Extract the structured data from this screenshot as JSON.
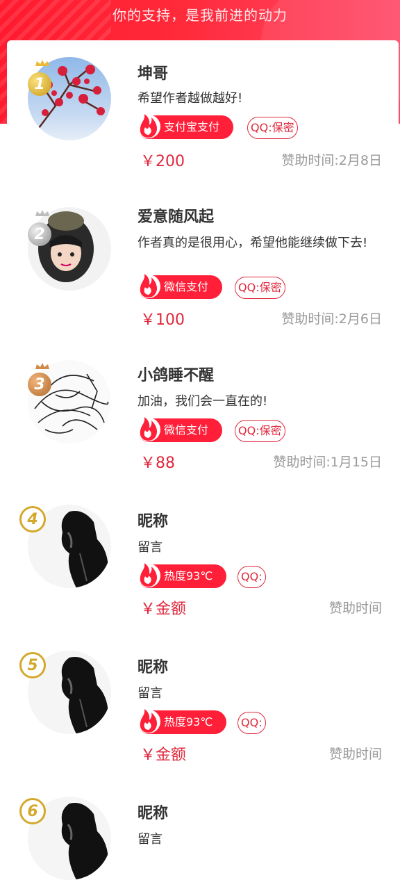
{
  "header": {
    "title": "你的支持，是我前进的动力"
  },
  "colors": {
    "accent": "#ff1f38",
    "gold": "#d4a82a",
    "muted": "#999999"
  },
  "entries": [
    {
      "rank": "1",
      "name": "坤哥",
      "message": "希望作者越做越好!",
      "pay": "支付宝支付",
      "qq": "QQ:保密",
      "amount": "￥200",
      "time": "赞助时间:2月8日"
    },
    {
      "rank": "2",
      "name": "爱意随风起",
      "message": "作者真的是很用心，希望他能继续做下去!",
      "pay": "微信支付",
      "qq": "QQ:保密",
      "amount": "￥100",
      "time": "赞助时间:2月6日"
    },
    {
      "rank": "3",
      "name": "小鸽睡不醒",
      "message": "加油，我们会一直在的!",
      "pay": "微信支付",
      "qq": "QQ:保密",
      "amount": "￥88",
      "time": "赞助时间:1月15日"
    },
    {
      "rank": "4",
      "name": "昵称",
      "message": "留言",
      "pay": "热度93℃",
      "qq": "QQ:",
      "amount": "￥金额",
      "time": "赞助时间"
    },
    {
      "rank": "5",
      "name": "昵称",
      "message": "留言",
      "pay": "热度93℃",
      "qq": "QQ:",
      "amount": "￥金额",
      "time": "赞助时间"
    },
    {
      "rank": "6",
      "name": "昵称",
      "message": "留言"
    }
  ]
}
